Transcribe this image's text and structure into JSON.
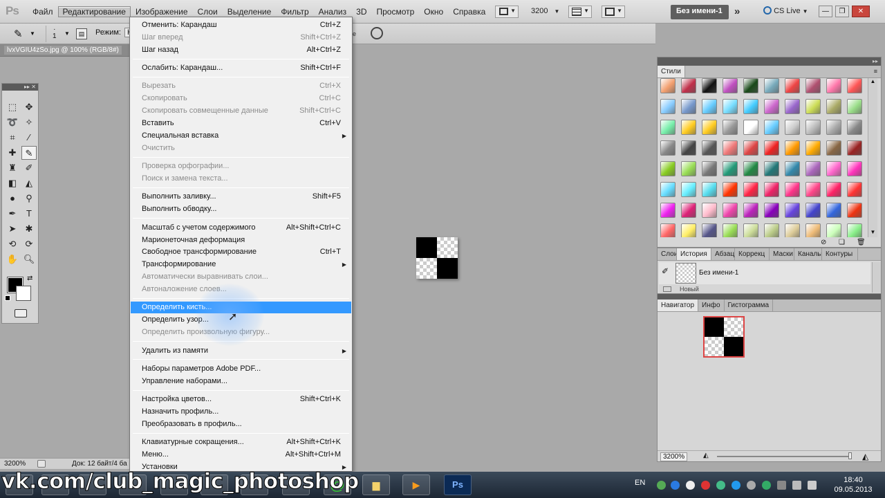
{
  "app": {
    "logo": "Ps"
  },
  "menubar": {
    "items": [
      "Файл",
      "Редактирование",
      "Изображение",
      "Слои",
      "Выделение",
      "Фильтр",
      "Анализ",
      "3D",
      "Просмотр",
      "Окно",
      "Справка"
    ],
    "active_index": 1,
    "zoom": "3200",
    "document_tab": "Без имени-1",
    "cs_live": "CS Live"
  },
  "optionsbar": {
    "brush_size": "1",
    "mode_label": "Режим:",
    "mode_value": "Н"
  },
  "doctab": {
    "file": "lvxVGIU4zSo.jpg @ 100% (RGB/8#)"
  },
  "status": {
    "zoom": "3200%",
    "doc": "Док: 12 байт/4 ба"
  },
  "edit_menu": {
    "items": [
      {
        "label": "Отменить: Карандаш",
        "shortcut": "Ctrl+Z",
        "disabled": false
      },
      {
        "label": "Шаг вперед",
        "shortcut": "Shift+Ctrl+Z",
        "disabled": true
      },
      {
        "label": "Шаг назад",
        "shortcut": "Alt+Ctrl+Z",
        "disabled": false
      },
      {
        "sep": true
      },
      {
        "label": "Ослабить: Карандаш...",
        "shortcut": "Shift+Ctrl+F",
        "disabled": false
      },
      {
        "sep": true
      },
      {
        "label": "Вырезать",
        "shortcut": "Ctrl+X",
        "disabled": true
      },
      {
        "label": "Скопировать",
        "shortcut": "Ctrl+C",
        "disabled": true
      },
      {
        "label": "Скопировать совмещенные данные",
        "shortcut": "Shift+Ctrl+C",
        "disabled": true
      },
      {
        "label": "Вставить",
        "shortcut": "Ctrl+V",
        "disabled": false
      },
      {
        "label": "Специальная вставка",
        "shortcut": "",
        "disabled": false,
        "submenu": true
      },
      {
        "label": "Очистить",
        "shortcut": "",
        "disabled": true
      },
      {
        "sep": true
      },
      {
        "label": "Проверка орфографии...",
        "shortcut": "",
        "disabled": true
      },
      {
        "label": "Поиск и замена текста...",
        "shortcut": "",
        "disabled": true
      },
      {
        "sep": true
      },
      {
        "label": "Выполнить заливку...",
        "shortcut": "Shift+F5",
        "disabled": false
      },
      {
        "label": "Выполнить обводку...",
        "shortcut": "",
        "disabled": false
      },
      {
        "sep": true
      },
      {
        "label": "Масштаб с учетом содержимого",
        "shortcut": "Alt+Shift+Ctrl+C",
        "disabled": false
      },
      {
        "label": "Марионеточная деформация",
        "shortcut": "",
        "disabled": false
      },
      {
        "label": "Свободное трансформирование",
        "shortcut": "Ctrl+T",
        "disabled": false
      },
      {
        "label": "Трансформирование",
        "shortcut": "",
        "disabled": false,
        "submenu": true
      },
      {
        "label": "Автоматически выравнивать слои...",
        "shortcut": "",
        "disabled": true
      },
      {
        "label": "Автоналожение слоев...",
        "shortcut": "",
        "disabled": true
      },
      {
        "sep": true
      },
      {
        "label": "Определить кисть...",
        "shortcut": "",
        "disabled": false,
        "highlighted": true
      },
      {
        "label": "Определить узор...",
        "shortcut": "",
        "disabled": false
      },
      {
        "label": "Определить произвольную фигуру...",
        "shortcut": "",
        "disabled": true
      },
      {
        "sep": true
      },
      {
        "label": "Удалить из памяти",
        "shortcut": "",
        "disabled": false,
        "submenu": true
      },
      {
        "sep": true
      },
      {
        "label": "Наборы параметров Adobe PDF...",
        "shortcut": "",
        "disabled": false
      },
      {
        "label": "Управление наборами...",
        "shortcut": "",
        "disabled": false
      },
      {
        "sep": true
      },
      {
        "label": "Настройка цветов...",
        "shortcut": "Shift+Ctrl+K",
        "disabled": false
      },
      {
        "label": "Назначить профиль...",
        "shortcut": "",
        "disabled": false
      },
      {
        "label": "Преобразовать в профиль...",
        "shortcut": "",
        "disabled": false
      },
      {
        "sep": true
      },
      {
        "label": "Клавиатурные сокращения...",
        "shortcut": "Alt+Shift+Ctrl+K",
        "disabled": false
      },
      {
        "label": "Меню...",
        "shortcut": "Alt+Shift+Ctrl+M",
        "disabled": false
      },
      {
        "label": "Установки",
        "shortcut": "",
        "disabled": false,
        "submenu": true
      }
    ]
  },
  "styles_panel": {
    "tab": "Стили"
  },
  "history_panel": {
    "tabs": [
      "Слои",
      "История",
      "Абзац",
      "Коррекц",
      "Маски",
      "Каналы",
      "Контуры"
    ],
    "active_index": 1,
    "snapshot": "Без имени-1",
    "row2": "Новый"
  },
  "navigator_panel": {
    "tabs": [
      "Навигатор",
      "Инфо",
      "Гистограмма"
    ],
    "active_index": 0,
    "zoom": "3200%"
  },
  "taskbar": {
    "watermark": "vk.com/club_magic_photoshop",
    "lang": "EN",
    "time": "18:40",
    "date": "09.05.2013",
    "ps_label": "Ps"
  }
}
